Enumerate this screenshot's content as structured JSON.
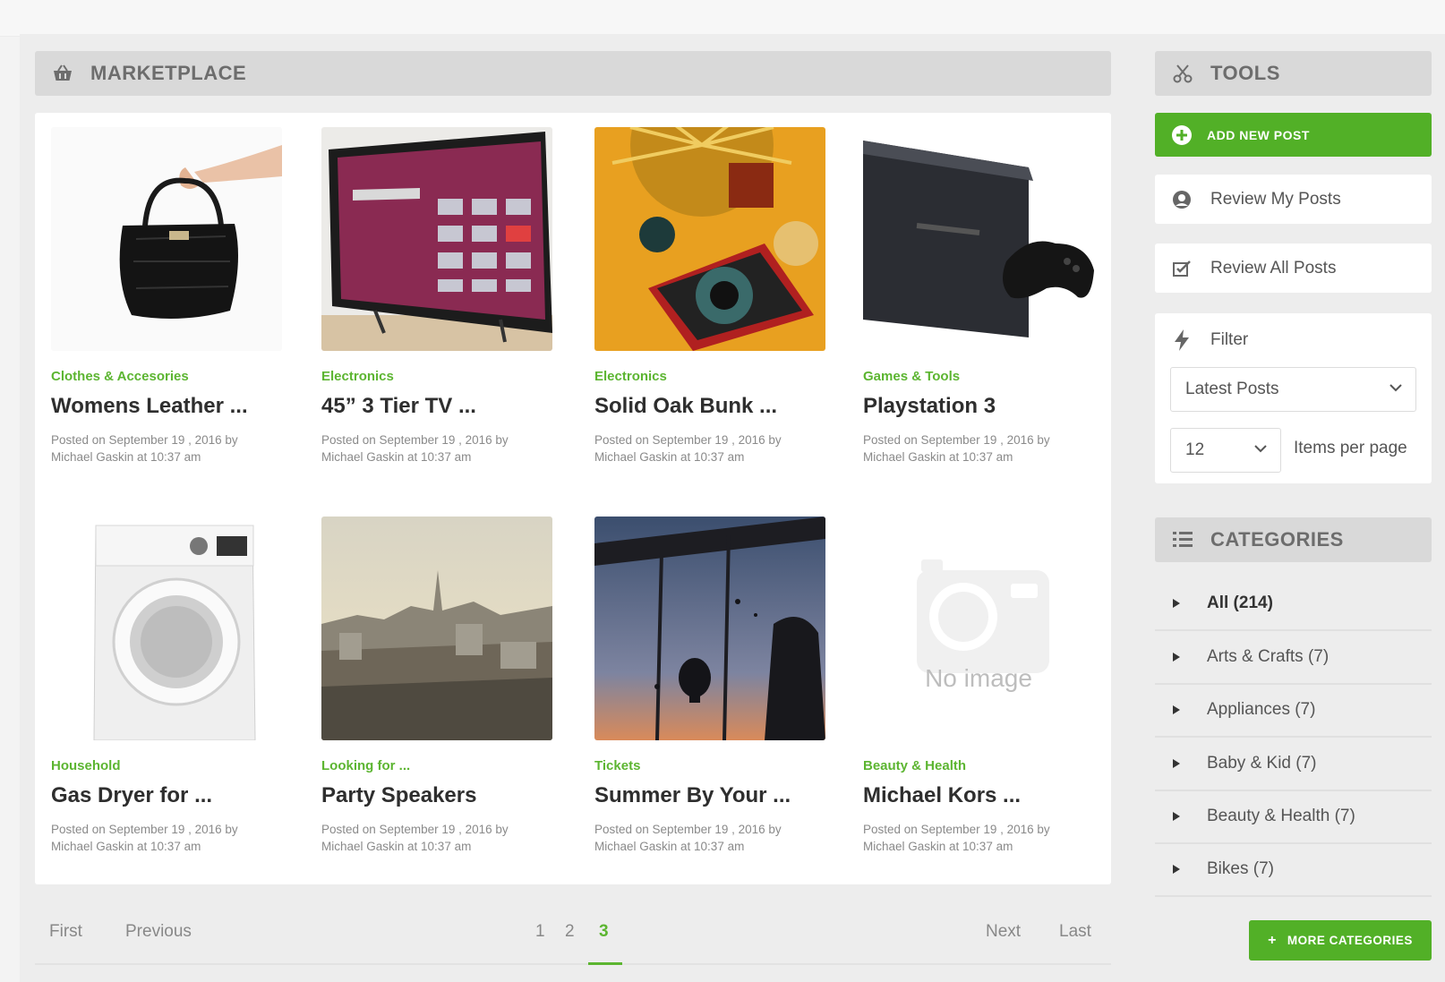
{
  "marketplace": {
    "title": "MARKETPLACE"
  },
  "posts": [
    {
      "category": "Clothes & Accesories",
      "title": "Womens Leather ...",
      "meta": "Posted on September 19 , 2016 by Michael Gaskin at 10:37 am",
      "image": "handbag"
    },
    {
      "category": "Electronics",
      "title": "45” 3 Tier TV ...",
      "meta": "Posted on September 19 , 2016 by Michael Gaskin at 10:37 am",
      "image": "tv"
    },
    {
      "category": "Electronics",
      "title": "Solid Oak Bunk ...",
      "meta": "Posted on September 19 , 2016 by Michael Gaskin at 10:37 am",
      "image": "vintage-camera"
    },
    {
      "category": "Games & Tools",
      "title": "Playstation 3",
      "meta": "Posted on September 19 , 2016 by Michael Gaskin at 10:37 am",
      "image": "playstation"
    },
    {
      "category": "Household",
      "title": "Gas Dryer for ...",
      "meta": "Posted on September 19 , 2016 by Michael Gaskin at 10:37 am",
      "image": "washer"
    },
    {
      "category": "Looking for ...",
      "title": "Party Speakers",
      "meta": "Posted on September 19 , 2016 by Michael Gaskin at 10:37 am",
      "image": "city"
    },
    {
      "category": "Tickets",
      "title": "Summer By Your ...",
      "meta": "Posted on September 19 , 2016 by Michael Gaskin at 10:37 am",
      "image": "balloons"
    },
    {
      "category": "Beauty & Health",
      "title": "Michael Kors ...",
      "meta": "Posted on September 19 , 2016 by Michael Gaskin at 10:37 am",
      "image": "no-image",
      "placeholder_text": "No image"
    }
  ],
  "pagination": {
    "first": "First",
    "previous": "Previous",
    "pages": [
      "1",
      "2",
      "3"
    ],
    "current": "3",
    "next": "Next",
    "last": "Last"
  },
  "tools": {
    "title": "TOOLS",
    "add_new_post": "ADD NEW POST",
    "review_my_posts": "Review My Posts",
    "review_all_posts": "Review All Posts",
    "filter_label": "Filter",
    "filter_value": "Latest Posts",
    "per_page_value": "12",
    "per_page_label": "Items per page"
  },
  "categories": {
    "title": "CATEGORIES",
    "items": [
      "All (214)",
      "Arts & Crafts (7)",
      "Appliances (7)",
      "Baby & Kid (7)",
      "Beauty & Health (7)",
      "Bikes (7)"
    ],
    "more": "MORE CATEGORIES"
  },
  "colors": {
    "accent": "#52b027",
    "category_text": "#5cb531",
    "bar_bg": "#d9d9d9"
  }
}
